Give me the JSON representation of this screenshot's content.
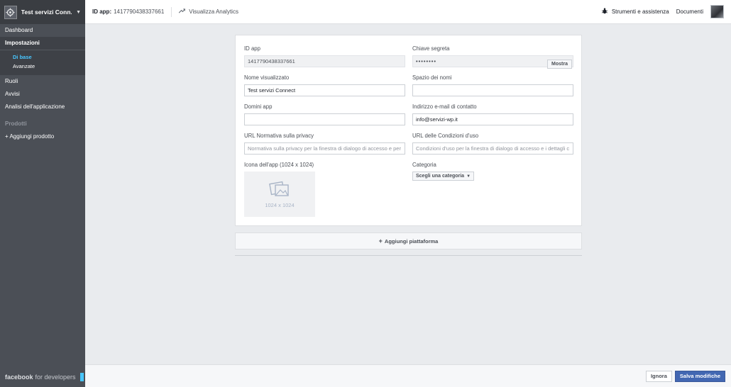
{
  "sidebar": {
    "app_name": "Test servizi Conn...",
    "items": {
      "dashboard": "Dashboard",
      "settings": "Impostazioni",
      "settings_basic": "Di base",
      "settings_advanced": "Avanzate",
      "roles": "Ruoli",
      "alerts": "Avvisi",
      "analytics": "Analisi dell'applicazione"
    },
    "products_header": "Prodotti",
    "add_product": "+ Aggiungi prodotto",
    "brand_facebook": "facebook",
    "brand_developers": "for developers",
    "brand_color": "#48c6ff"
  },
  "topbar": {
    "app_id_label": "ID app:",
    "app_id_value": "1417790438337661",
    "analytics_link": "Visualizza Analytics",
    "tools": "Strumenti e assistenza",
    "docs": "Documenti"
  },
  "form": {
    "app_id": {
      "label": "ID app",
      "value": "1417790438337661"
    },
    "secret": {
      "label": "Chiave segreta",
      "value": "••••••••",
      "show": "Mostra"
    },
    "display_name": {
      "label": "Nome visualizzato",
      "value": "Test servizi Connect"
    },
    "namespace": {
      "label": "Spazio dei nomi",
      "value": ""
    },
    "app_domains": {
      "label": "Domini app",
      "value": ""
    },
    "contact_email": {
      "label": "Indirizzo e-mail di contatto",
      "value": "info@servizi-wp.it"
    },
    "privacy_url": {
      "label": "URL Normativa sulla privacy",
      "placeholder": "Normativa sulla privacy per la finestra di dialogo di accesso e per"
    },
    "terms_url": {
      "label": "URL delle Condizioni d'uso",
      "placeholder": "Condizioni d'uso per la finestra di dialogo di accesso e i dettagli c"
    },
    "app_icon": {
      "label": "Icona dell'app (1024 x 1024)",
      "size": "1024 x 1024"
    },
    "category": {
      "label": "Categoria",
      "button": "Scegli una categoria"
    }
  },
  "add_platform": "Aggiungi piattaforma",
  "footer": {
    "cancel": "Ignora",
    "save": "Salva modifiche"
  },
  "colors": {
    "sidebar_bg": "#4b4f56",
    "primary": "#4267b2",
    "active_link": "#48c6ff"
  }
}
